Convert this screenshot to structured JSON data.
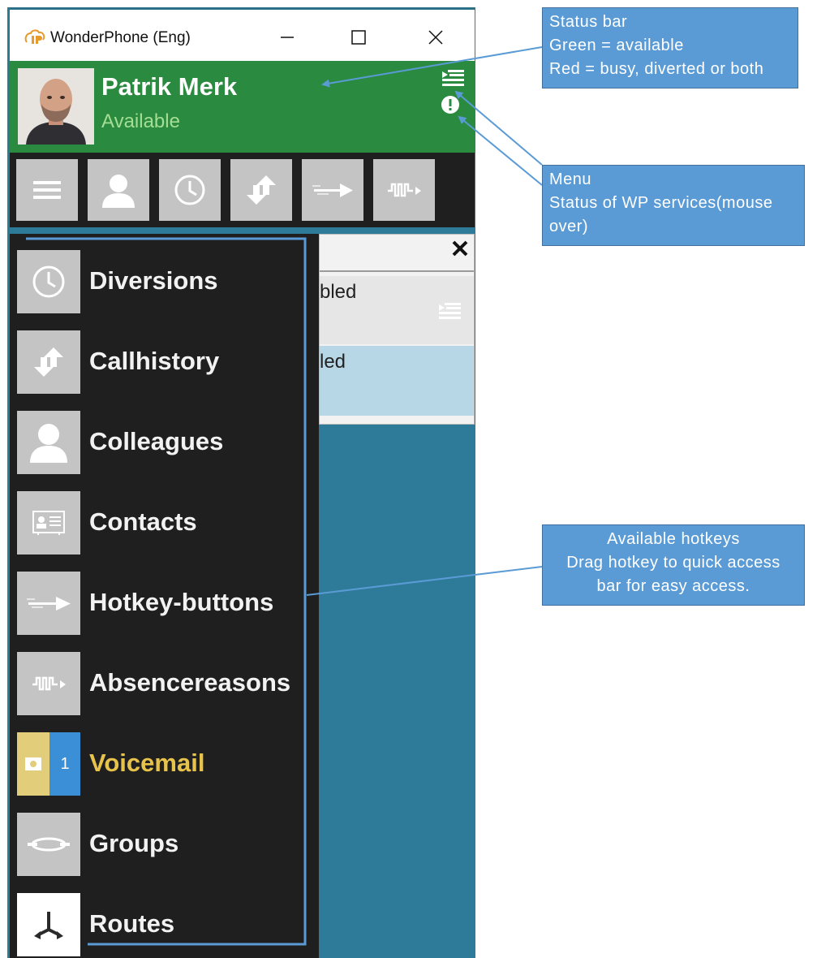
{
  "window": {
    "title": "WonderPhone (Eng)",
    "controls": {
      "minimize": "—",
      "maximize": "☐",
      "close": "✕"
    }
  },
  "status_bar": {
    "user_name": "Patrik Merk",
    "status": "Available",
    "status_color": "#2a8a40",
    "status_text_color": "#a4de94"
  },
  "toolbar": {
    "buttons": [
      {
        "icon": "hamburger-menu-icon"
      },
      {
        "icon": "person-icon"
      },
      {
        "icon": "clock-icon"
      },
      {
        "icon": "call-history-icon"
      },
      {
        "icon": "hotkey-arrow-icon"
      },
      {
        "icon": "absence-wave-icon"
      }
    ]
  },
  "panel": {
    "row1_text": "bled",
    "row2_text": "led",
    "close_glyph": "✕"
  },
  "menu": {
    "items": [
      {
        "label": "Diversions",
        "icon": "clock-icon"
      },
      {
        "label": "Callhistory",
        "icon": "call-history-icon"
      },
      {
        "label": "Colleagues",
        "icon": "person-icon"
      },
      {
        "label": "Contacts",
        "icon": "contact-card-icon"
      },
      {
        "label": "Hotkey-buttons",
        "icon": "hotkey-arrow-icon"
      },
      {
        "label": "Absencereasons",
        "icon": "absence-wave-icon"
      },
      {
        "label": "Voicemail",
        "icon": "voicemail-icon",
        "badge": "1"
      },
      {
        "label": "Groups",
        "icon": "groups-icon"
      },
      {
        "label": "Routes",
        "icon": "routes-icon"
      }
    ],
    "voicemail_color": "#e8c34c"
  },
  "callouts": {
    "status_bar": [
      "Status bar",
      "Green = available",
      "Red = busy, diverted or both"
    ],
    "menu": [
      "Menu",
      "Status of WP services(mouse",
      "over)"
    ],
    "hotkeys": [
      "Available hotkeys",
      "Drag hotkey to quick access",
      "bar for easy access."
    ]
  },
  "colors": {
    "accent": "#5b9bd5",
    "window_bg": "#2e7b99",
    "menu_bg": "#1f1f1f",
    "tile_bg": "#c4c4c4"
  }
}
